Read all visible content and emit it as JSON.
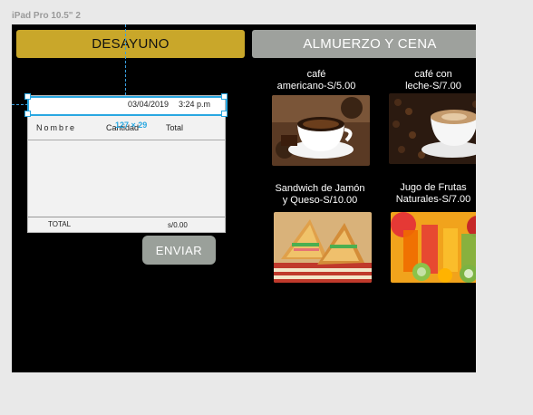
{
  "device_label": "iPad Pro 10.5\" 2",
  "tabs": {
    "desayuno": "DESAYUNO",
    "almuerzo": "ALMUERZO Y CENA"
  },
  "order": {
    "date": "03/04/2019",
    "time": "3:24 p.m",
    "overlap_number": "127 × 29",
    "columns": {
      "nombre": "Nombre",
      "cantidad": "Cantidad",
      "total": "Total"
    },
    "total_label": "TOTAL",
    "total_value": "s/0.00"
  },
  "send_button": "ENVIAR",
  "products": [
    {
      "line1": "café",
      "line2": "americano-S/5.00"
    },
    {
      "line1": "café con",
      "line2": "leche-S/7.00"
    },
    {
      "line1": "Sandwich de Jamón",
      "line2": "y Queso-S/10.00"
    },
    {
      "line1": "Jugo de  Frutas",
      "line2": "Naturales-S/7.00"
    }
  ]
}
